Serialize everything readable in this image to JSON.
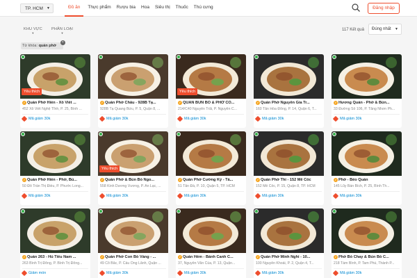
{
  "header": {
    "city": "TP. HCM",
    "nav": [
      "Đồ ăn",
      "Thực phẩm",
      "Rượu bia",
      "Hoa",
      "Siêu thị",
      "Thuốc",
      "Thú cưng"
    ],
    "login_label": "Đăng nhập"
  },
  "filters": {
    "area": "KHU VỰC",
    "category": "PHÂN LOẠI",
    "result_count": "117 Kết quả",
    "sort": "Đúng nhất",
    "keyword_prefix": "Từ khóa:",
    "keyword": "quán phở"
  },
  "favorite_label": "Yêu thích",
  "restaurants": [
    {
      "name": "Quán Phở Hiền - Xô Viết ...",
      "address": "452 Xô Viết Nghệ Tĩnh, P. 25, Bình ...",
      "promo": "Mã giảm 30k",
      "favorite": true
    },
    {
      "name": "Quán Phở Châu - 928B Tạ...",
      "address": "928B Tạ Quang Bửu, P. 5, Quận 8, ...",
      "promo": "Mã giảm 30k",
      "favorite": false
    },
    {
      "name": "QUÁN BÚN BÒ & PHỞ CÔ...",
      "address": "214/C40 Nguyễn Trãi, P. Nguyễn C...",
      "promo": "Mã giảm 30k",
      "favorite": true
    },
    {
      "name": "Quán Phở Nguyễn Gia Tr...",
      "address": "160 Tân Hòa Đông, P. 14, Quận 6, T...",
      "promo": "Mã giảm 30k",
      "favorite": false
    },
    {
      "name": "Hương Quán - Phở & Bún...",
      "address": "33 Đường Số 106, P. Tăng Nhơn Ph...",
      "promo": "Mã giảm 30k",
      "favorite": false
    },
    {
      "name": "Quán Phở Hiền - Phở, Bú...",
      "address": "50 Đỗ Trần Thị Điều, P. Phước Long...",
      "promo": "Mã giảm 30k",
      "favorite": false
    },
    {
      "name": "Quán Phở & Bún Bò Ngo...",
      "address": "558 Kinh Dương Vương, P. An Lạc, ...",
      "promo": "Mã giảm 30k",
      "favorite": true
    },
    {
      "name": "Quán Phở Cường Ký - Tả...",
      "address": "51 Tân Đà, P. 10, Quận 5, TP. HCM",
      "promo": "Mã giảm 30k",
      "favorite": false
    },
    {
      "name": "Quán Phở Thi - 152 Mễ Cốc",
      "address": "152 Mễ Cốc, P. 15, Quận 8, TP. HCM",
      "promo": "Mã giảm 30k",
      "favorite": false
    },
    {
      "name": "Phở - Béo Quán",
      "address": "145 Lũy Bán Bích, P. 25, Bình Th...",
      "promo": "Mã giảm 30k",
      "favorite": false
    },
    {
      "name": "Quán 263 - Hủ Tiếu Nam ...",
      "address": "263 Bình Trị Đông, P. Bình Trị Đông...",
      "promo": "Giảm món",
      "favorite": false
    },
    {
      "name": "Quán Phở Con Bò Vàng - ...",
      "address": "49 Cô Bắc, P. Cầu Ông Lãnh, Quận ...",
      "promo": "Mã giảm 30k",
      "favorite": false
    },
    {
      "name": "Quán Hẻm - Bánh Canh C...",
      "address": "37, Nguyễn Văn Của, P. 13, Quận...",
      "promo": "Mã giảm 30k",
      "favorite": false
    },
    {
      "name": "Quán Phở Minh Nghi - 10...",
      "address": "100 Nguyễn Khoái, P. 2, Quận 4, T...",
      "promo": "Mã giảm 30k",
      "favorite": false
    },
    {
      "name": "Phở Bò Chay & Bún Bò C...",
      "address": "218 Tám Bình, P. Tam Phú, Thành P...",
      "promo": "Mã giảm 30k",
      "favorite": false
    }
  ]
}
